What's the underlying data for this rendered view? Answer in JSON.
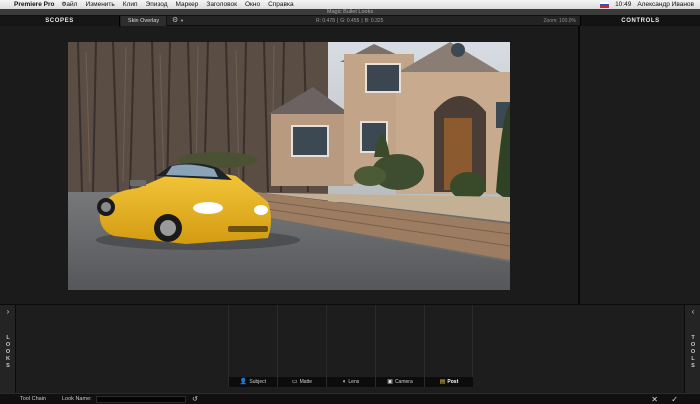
{
  "menubar": {
    "apple_icon": "apple-icon",
    "app": "Premiere Pro",
    "items": [
      "Файл",
      "Изменить",
      "Клип",
      "Эпизод",
      "Маркер",
      "Заголовок",
      "Окно",
      "Справка"
    ],
    "time": "10:49",
    "user": "Александр Иванов"
  },
  "window": {
    "title": "Magic Bullet Looks"
  },
  "toolbar": {
    "scopes_tab": "SCOPES",
    "skin_overlay": "Skin Overlay",
    "gear_icon": "gear-icon",
    "readout": {
      "r": "R: 0.478",
      "g": "G: 0.455",
      "b": "B: 0.325"
    },
    "zoom": "Zoom: 100.0%",
    "controls_tab": "CONTROLS"
  },
  "side_tabs": {
    "left": {
      "label": "LOOKS",
      "arrow": "›"
    },
    "right": {
      "label": "TOOLS",
      "arrow": "‹"
    }
  },
  "tool_chain": {
    "steps": [
      {
        "label": "Subject",
        "icon": "subject-icon",
        "active": false
      },
      {
        "label": "Matte",
        "icon": "matte-icon",
        "active": false
      },
      {
        "label": "Lens",
        "icon": "lens-icon",
        "active": false
      },
      {
        "label": "Camera",
        "icon": "camera-icon",
        "active": false
      },
      {
        "label": "Post",
        "icon": "post-icon",
        "active": true
      }
    ]
  },
  "statusbar": {
    "tool_chain_label": "Tool Chain",
    "look_name_label": "Look Name:",
    "look_name_value": "",
    "undo_icon": "undo-icon",
    "cancel_icon": "cancel-icon",
    "ok_icon": "checkmark-icon"
  },
  "colors": {
    "background": "#1b1b1b",
    "active_step": "#e7c23a",
    "car": "#e8b21c"
  }
}
